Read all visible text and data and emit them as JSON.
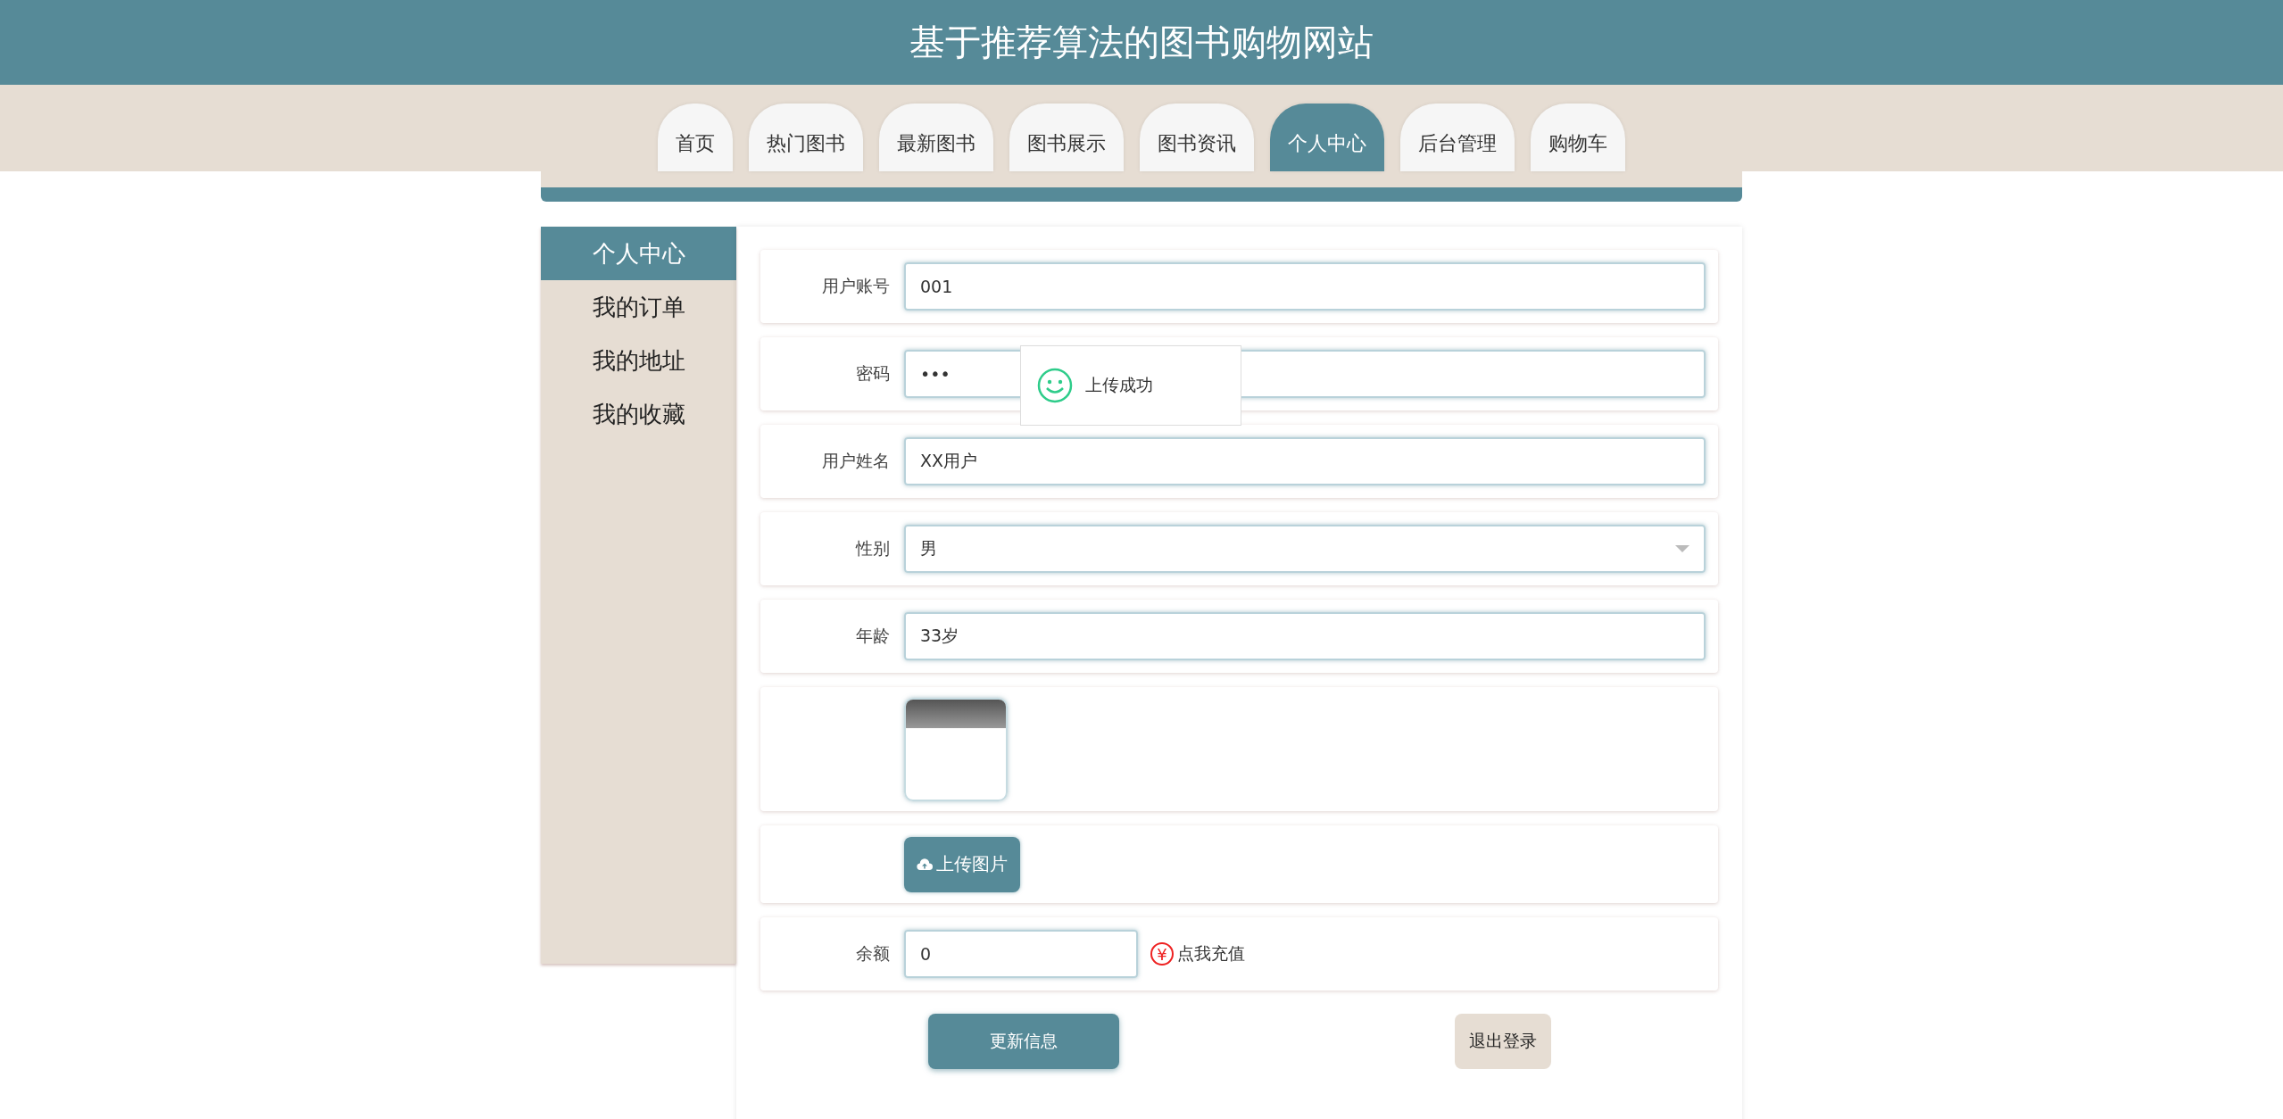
{
  "header": {
    "title": "基于推荐算法的图书购物网站"
  },
  "nav": [
    {
      "label": "首页",
      "selected": false
    },
    {
      "label": "热门图书",
      "selected": false
    },
    {
      "label": "最新图书",
      "selected": false
    },
    {
      "label": "图书展示",
      "selected": false
    },
    {
      "label": "图书资讯",
      "selected": false
    },
    {
      "label": "个人中心",
      "selected": true
    },
    {
      "label": "后台管理",
      "selected": false
    },
    {
      "label": "购物车",
      "selected": false
    }
  ],
  "sidebar": [
    {
      "label": "个人中心",
      "selected": true
    },
    {
      "label": "我的订单",
      "selected": false
    },
    {
      "label": "我的地址",
      "selected": false
    },
    {
      "label": "我的收藏",
      "selected": false
    }
  ],
  "fields": [
    {
      "kind": "text",
      "label": "用户账号",
      "value": "001"
    },
    {
      "kind": "text",
      "label": "密码",
      "value": "•••"
    },
    {
      "kind": "text",
      "label": "用户姓名",
      "value": "XX用户"
    },
    {
      "kind": "select",
      "label": "性别",
      "value": "男"
    },
    {
      "kind": "text",
      "label": "年龄",
      "value": "33岁"
    }
  ],
  "upload_button": "上传图片",
  "balance": {
    "label": "余额",
    "value": "0",
    "recharge_link": "点我充值",
    "currency_symbol": "¥"
  },
  "buttons": {
    "update": "更新信息",
    "logout": "退出登录"
  },
  "toast": {
    "message": "上传成功"
  }
}
